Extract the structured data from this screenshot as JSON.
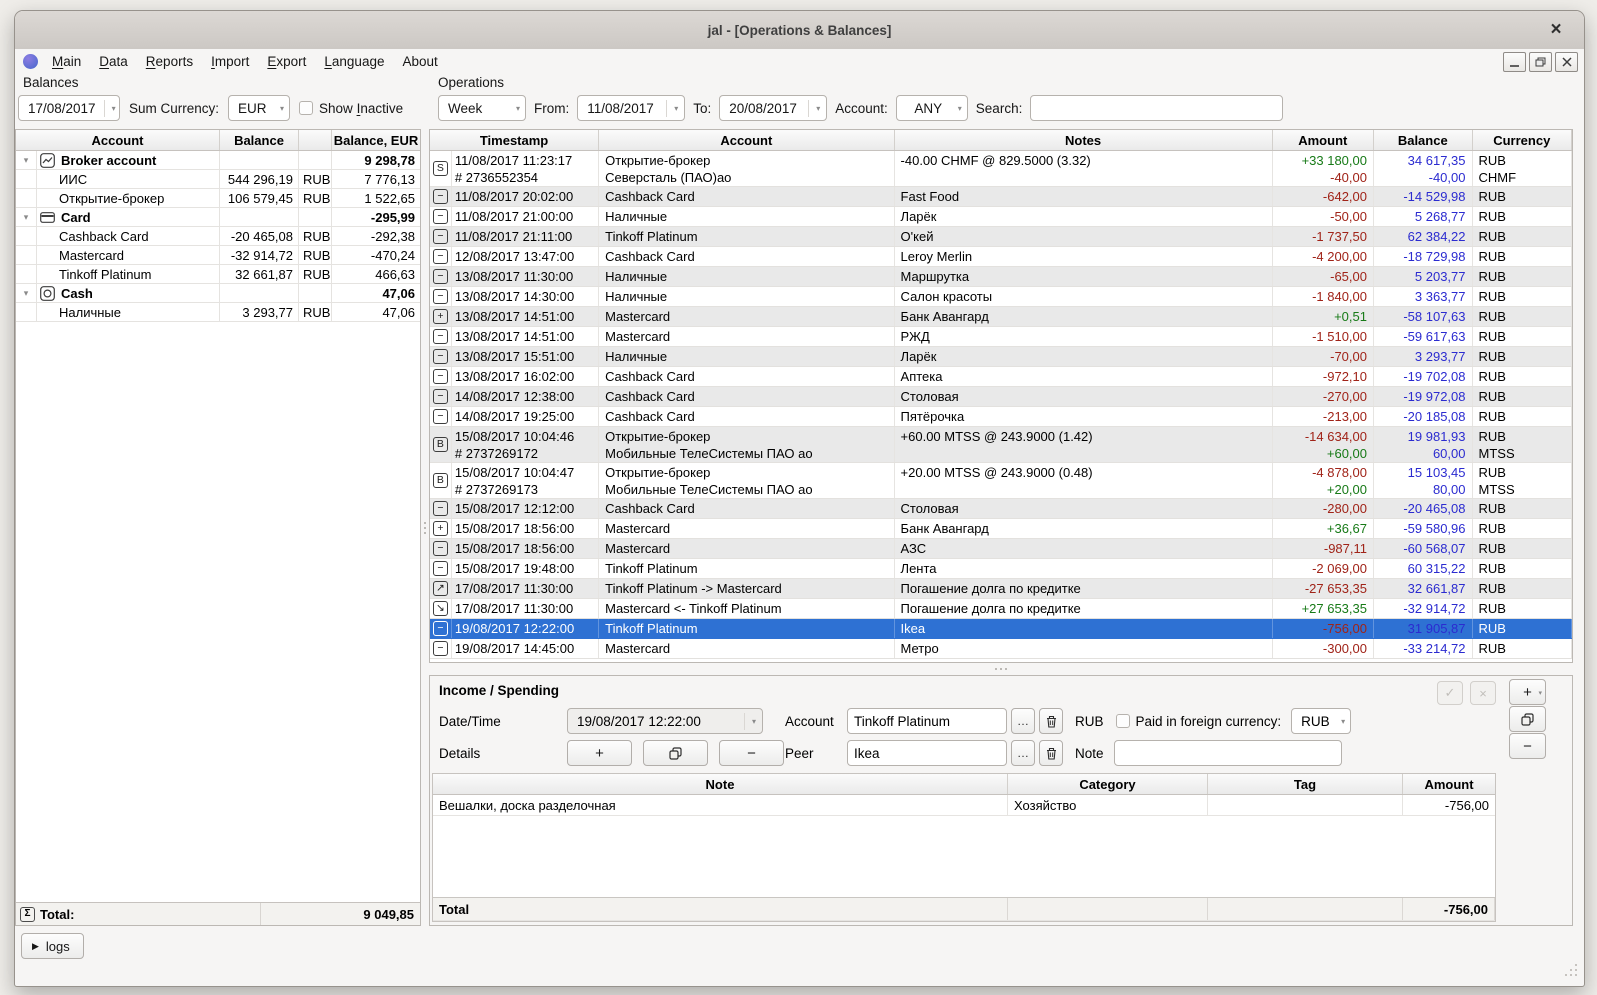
{
  "window": {
    "title": "jal - [Operations & Balances]"
  },
  "icons": {
    "close": "×",
    "dropdown": "▾",
    "expander": "▾",
    "sigma": "Σ",
    "play": "▶",
    "check": "✓",
    "cross": "×",
    "plus": "+",
    "minus": "−",
    "ellipsis": "…",
    "trade-sell": "S",
    "trade-buy": "B",
    "spend": "−",
    "income": "+",
    "transfer-out": "↗",
    "transfer-in": "↘"
  },
  "menu": {
    "items": [
      {
        "label": "Main",
        "mnemonic": "M"
      },
      {
        "label": "Data",
        "mnemonic": "D"
      },
      {
        "label": "Reports",
        "mnemonic": "R"
      },
      {
        "label": "Import",
        "mnemonic": "I"
      },
      {
        "label": "Export",
        "mnemonic": "E"
      },
      {
        "label": "Language",
        "mnemonic": "L"
      },
      {
        "label": "About",
        "mnemonic": ""
      }
    ]
  },
  "balances": {
    "panel_label": "Balances",
    "date": "17/08/2017",
    "sum_currency_label": "Sum Currency:",
    "sum_currency": "EUR",
    "show_inactive": {
      "label": "Show Inactive",
      "mnemonic": "I"
    },
    "headers": {
      "account": "Account",
      "balance": "Balance",
      "balance_eur": "Balance, EUR"
    },
    "rows": [
      {
        "type": "group",
        "icon": "chart-icon",
        "name": "Broker account",
        "balance": "",
        "currency": "",
        "eur": "9 298,78"
      },
      {
        "type": "child",
        "name": "ИИС",
        "balance": "544 296,19",
        "currency": "RUB",
        "eur": "7 776,13"
      },
      {
        "type": "child",
        "name": "Открытие-брокер",
        "balance": "106 579,45",
        "currency": "RUB",
        "eur": "1 522,65"
      },
      {
        "type": "group",
        "icon": "card-icon",
        "name": "Card",
        "balance": "",
        "currency": "",
        "eur": "-295,99"
      },
      {
        "type": "child",
        "name": "Cashback Card",
        "balance": "-20 465,08",
        "currency": "RUB",
        "eur": "-292,38"
      },
      {
        "type": "child",
        "name": "Mastercard",
        "balance": "-32 914,72",
        "currency": "RUB",
        "eur": "-470,24"
      },
      {
        "type": "child",
        "name": "Tinkoff Platinum",
        "balance": "32 661,87",
        "currency": "RUB",
        "eur": "466,63"
      },
      {
        "type": "group",
        "icon": "cash-icon",
        "name": "Cash",
        "balance": "",
        "currency": "",
        "eur": "47,06"
      },
      {
        "type": "child",
        "name": "Наличные",
        "balance": "3 293,77",
        "currency": "RUB",
        "eur": "47,06"
      }
    ],
    "total_label": "Total:",
    "total_value": "9 049,85"
  },
  "operations": {
    "panel_label": "Operations",
    "period": "Week",
    "from_label": "From:",
    "from_date": "11/08/2017",
    "to_label": "To:",
    "to_date": "20/08/2017",
    "account_label": "Account:",
    "account_value": "ANY",
    "search_label": "Search:",
    "search_value": "",
    "headers": {
      "timestamp": "Timestamp",
      "account": "Account",
      "notes": "Notes",
      "amount": "Amount",
      "balance": "Balance",
      "currency": "Currency"
    },
    "rows": [
      {
        "icon": "trade-sell",
        "ts": "11/08/2017 11:23:17",
        "ts2": "# 2736552354",
        "acc": "Открытие-брокер",
        "acc2": "Северсталь (ПАО)ао",
        "note": "-40.00 CHMF @ 829.5000 (3.32)",
        "amt": "+33 180,00",
        "amt2": "-40,00",
        "bal": "34 617,35",
        "bal2": "-40,00",
        "cur": "RUB",
        "cur2": "CHMF"
      },
      {
        "icon": "spend",
        "ts": "11/08/2017 20:02:00",
        "acc": "Cashback Card",
        "note": "Fast Food",
        "amt": "-642,00",
        "bal": "-14 529,98",
        "cur": "RUB"
      },
      {
        "icon": "spend",
        "ts": "11/08/2017 21:00:00",
        "acc": "Наличные",
        "note": "Ларёк",
        "amt": "-50,00",
        "bal": "5 268,77",
        "cur": "RUB"
      },
      {
        "icon": "spend",
        "ts": "11/08/2017 21:11:00",
        "acc": "Tinkoff Platinum",
        "note": "О'кей",
        "amt": "-1 737,50",
        "bal": "62 384,22",
        "cur": "RUB"
      },
      {
        "icon": "spend",
        "ts": "12/08/2017 13:47:00",
        "acc": "Cashback Card",
        "note": "Leroy Merlin",
        "amt": "-4 200,00",
        "bal": "-18 729,98",
        "cur": "RUB"
      },
      {
        "icon": "spend",
        "ts": "13/08/2017 11:30:00",
        "acc": "Наличные",
        "note": "Маршрутка",
        "amt": "-65,00",
        "bal": "5 203,77",
        "cur": "RUB"
      },
      {
        "icon": "spend",
        "ts": "13/08/2017 14:30:00",
        "acc": "Наличные",
        "note": "Салон красоты",
        "amt": "-1 840,00",
        "bal": "3 363,77",
        "cur": "RUB"
      },
      {
        "icon": "income",
        "ts": "13/08/2017 14:51:00",
        "acc": "Mastercard",
        "note": "Банк Авангард",
        "amt": "+0,51",
        "bal": "-58 107,63",
        "cur": "RUB"
      },
      {
        "icon": "spend",
        "ts": "13/08/2017 14:51:00",
        "acc": "Mastercard",
        "note": "РЖД",
        "amt": "-1 510,00",
        "bal": "-59 617,63",
        "cur": "RUB"
      },
      {
        "icon": "spend",
        "ts": "13/08/2017 15:51:00",
        "acc": "Наличные",
        "note": "Ларёк",
        "amt": "-70,00",
        "bal": "3 293,77",
        "cur": "RUB"
      },
      {
        "icon": "spend",
        "ts": "13/08/2017 16:02:00",
        "acc": "Cashback Card",
        "note": "Аптека",
        "amt": "-972,10",
        "bal": "-19 702,08",
        "cur": "RUB"
      },
      {
        "icon": "spend",
        "ts": "14/08/2017 12:38:00",
        "acc": "Cashback Card",
        "note": "Столовая",
        "amt": "-270,00",
        "bal": "-19 972,08",
        "cur": "RUB"
      },
      {
        "icon": "spend",
        "ts": "14/08/2017 19:25:00",
        "acc": "Cashback Card",
        "note": "Пятёрочка",
        "amt": "-213,00",
        "bal": "-20 185,08",
        "cur": "RUB"
      },
      {
        "icon": "trade-buy",
        "ts": "15/08/2017 10:04:46",
        "ts2": "# 2737269172",
        "acc": "Открытие-брокер",
        "acc2": "Мобильные ТелеСистемы ПАО ао",
        "note": "+60.00 MTSS @ 243.9000 (1.42)",
        "amt": "-14 634,00",
        "amt2": "+60,00",
        "bal": "19 981,93",
        "bal2": "60,00",
        "cur": "RUB",
        "cur2": "MTSS"
      },
      {
        "icon": "trade-buy",
        "ts": "15/08/2017 10:04:47",
        "ts2": "# 2737269173",
        "acc": "Открытие-брокер",
        "acc2": "Мобильные ТелеСистемы ПАО ао",
        "note": "+20.00 MTSS @ 243.9000 (0.48)",
        "amt": "-4 878,00",
        "amt2": "+20,00",
        "bal": "15 103,45",
        "bal2": "80,00",
        "cur": "RUB",
        "cur2": "MTSS"
      },
      {
        "icon": "spend",
        "ts": "15/08/2017 12:12:00",
        "acc": "Cashback Card",
        "note": "Столовая",
        "amt": "-280,00",
        "bal": "-20 465,08",
        "cur": "RUB"
      },
      {
        "icon": "income",
        "ts": "15/08/2017 18:56:00",
        "acc": "Mastercard",
        "note": "Банк Авангард",
        "amt": "+36,67",
        "bal": "-59 580,96",
        "cur": "RUB"
      },
      {
        "icon": "spend",
        "ts": "15/08/2017 18:56:00",
        "acc": "Mastercard",
        "note": "АЗС",
        "amt": "-987,11",
        "bal": "-60 568,07",
        "cur": "RUB"
      },
      {
        "icon": "spend",
        "ts": "15/08/2017 19:48:00",
        "acc": "Tinkoff Platinum",
        "note": "Лента",
        "amt": "-2 069,00",
        "bal": "60 315,22",
        "cur": "RUB"
      },
      {
        "icon": "transfer-out",
        "ts": "17/08/2017 11:30:00",
        "acc": "Tinkoff Platinum -> Mastercard",
        "note": "Погашение долга по кредитке",
        "amt": "-27 653,35",
        "bal": "32 661,87",
        "cur": "RUB"
      },
      {
        "icon": "transfer-in",
        "ts": "17/08/2017 11:30:00",
        "acc": "Mastercard <- Tinkoff Platinum",
        "note": "Погашение долга по кредитке",
        "amt": "+27 653,35",
        "bal": "-32 914,72",
        "cur": "RUB"
      },
      {
        "icon": "spend",
        "ts": "19/08/2017 12:22:00",
        "acc": "Tinkoff Platinum",
        "note": "Ikea",
        "amt": "-756,00",
        "bal": "31 905,87",
        "cur": "RUB",
        "selected": true
      },
      {
        "icon": "spend",
        "ts": "19/08/2017 14:45:00",
        "acc": "Mastercard",
        "note": "Метро",
        "amt": "-300,00",
        "bal": "-33 214,72",
        "cur": "RUB"
      }
    ]
  },
  "income_spending": {
    "title": "Income / Spending",
    "datetime_label": "Date/Time",
    "datetime_value": "19/08/2017 12:22:00",
    "account_label": "Account",
    "account_value": "Tinkoff Platinum",
    "account_currency": "RUB",
    "paid_foreign_label": "Paid in foreign currency:",
    "foreign_currency": "RUB",
    "details_label": "Details",
    "peer_label": "Peer",
    "peer_value": "Ikea",
    "note_label": "Note",
    "note_value": "",
    "table": {
      "headers": {
        "note": "Note",
        "category": "Category",
        "tag": "Tag",
        "amount": "Amount"
      },
      "rows": [
        {
          "note": "Вешалки, доска разделочная",
          "category": "Хозяйство",
          "tag": "",
          "amount": "-756,00"
        }
      ],
      "total_label": "Total",
      "total_amount": "-756,00"
    }
  },
  "logs": {
    "label": "logs"
  }
}
